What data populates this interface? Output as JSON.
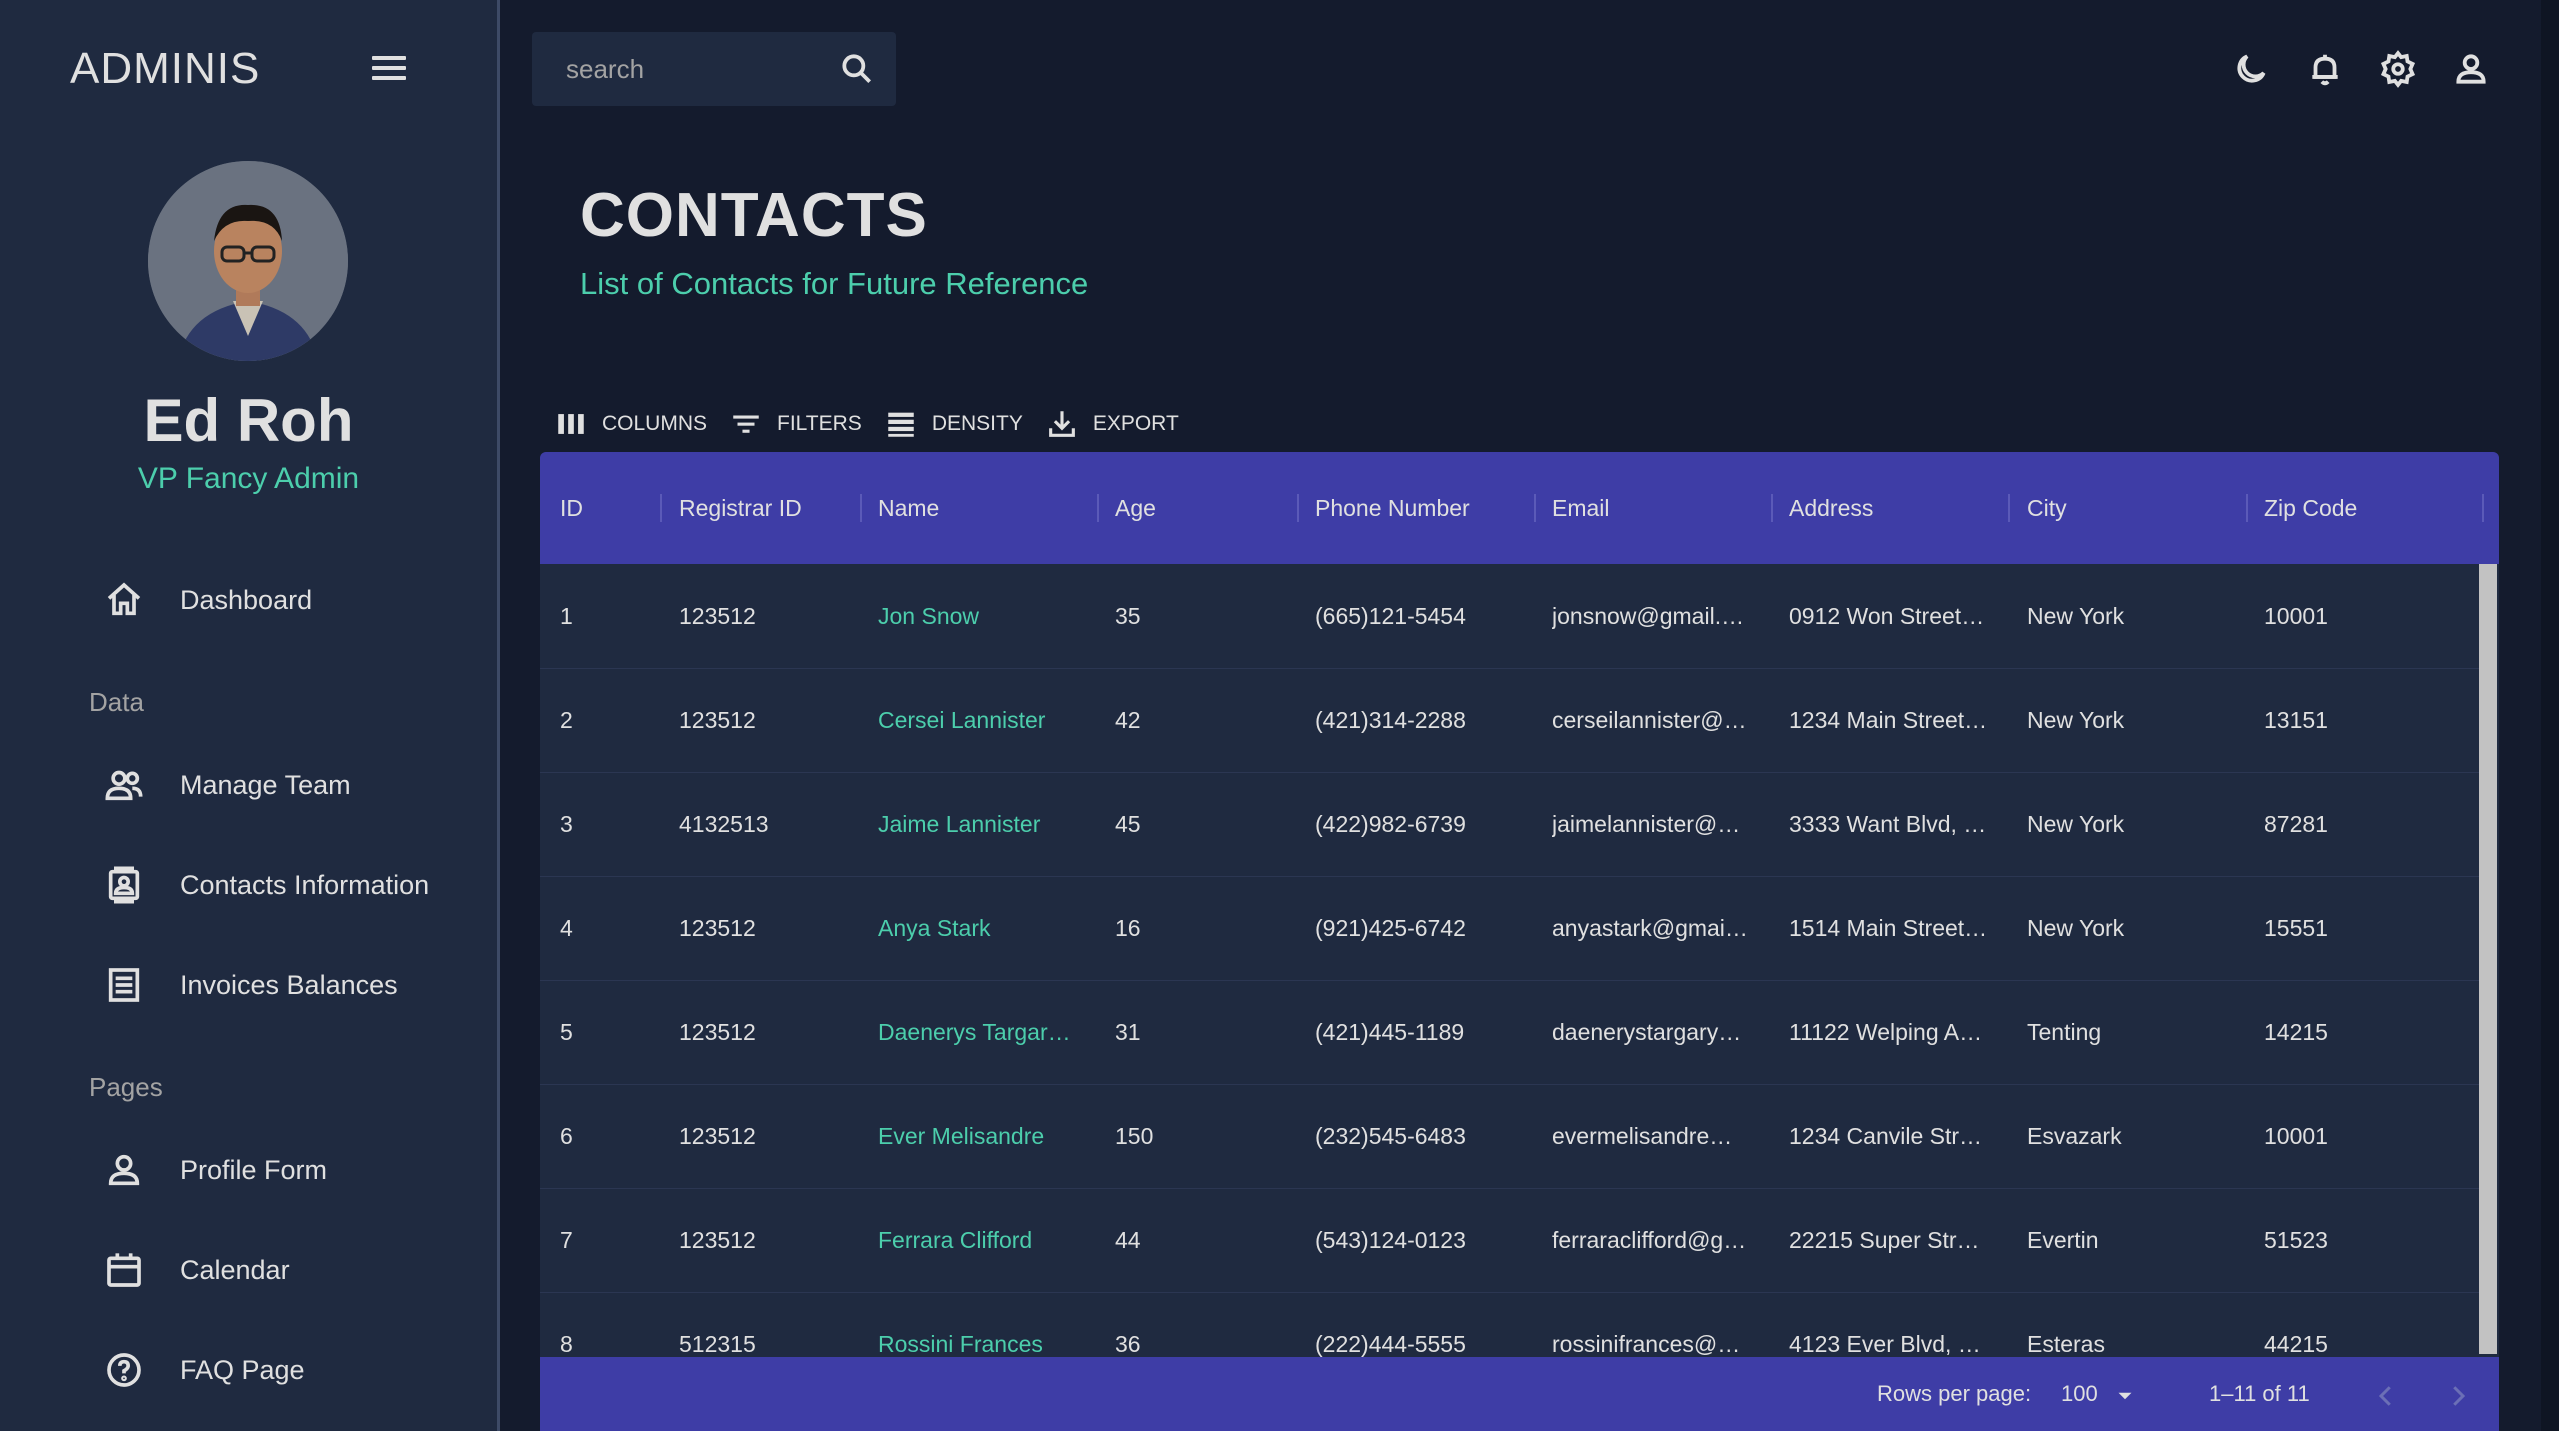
{
  "sidebar": {
    "brand": "ADMINIS",
    "user_name": "Ed Roh",
    "user_role": "VP Fancy Admin",
    "sections": [
      "Data",
      "Pages"
    ],
    "items": [
      {
        "label": "Dashboard",
        "icon": "home-icon"
      },
      {
        "label": "Manage Team",
        "icon": "people-icon"
      },
      {
        "label": "Contacts Information",
        "icon": "contacts-icon"
      },
      {
        "label": "Invoices Balances",
        "icon": "receipt-icon"
      },
      {
        "label": "Profile Form",
        "icon": "person-icon"
      },
      {
        "label": "Calendar",
        "icon": "calendar-icon"
      },
      {
        "label": "FAQ Page",
        "icon": "help-icon"
      }
    ]
  },
  "topbar": {
    "search_placeholder": "search",
    "icons": [
      "dark-mode-icon",
      "notifications-icon",
      "settings-icon",
      "profile-icon"
    ]
  },
  "header": {
    "title": "CONTACTS",
    "subtitle": "List of Contacts for Future Reference"
  },
  "toolbar": {
    "columns": "COLUMNS",
    "filters": "FILTERS",
    "density": "DENSITY",
    "export": "EXPORT"
  },
  "table": {
    "headers": [
      "ID",
      "Registrar ID",
      "Name",
      "Age",
      "Phone Number",
      "Email",
      "Address",
      "City",
      "Zip Code"
    ],
    "rows": [
      [
        "1",
        "123512",
        "Jon Snow",
        "35",
        "(665)121-5454",
        "jonsnow@gmail.…",
        "0912 Won Street, …",
        "New York",
        "10001"
      ],
      [
        "2",
        "123512",
        "Cersei Lannister",
        "42",
        "(421)314-2288",
        "cerseilannister@…",
        "1234 Main Street,…",
        "New York",
        "13151"
      ],
      [
        "3",
        "4132513",
        "Jaime Lannister",
        "45",
        "(422)982-6739",
        "jaimelannister@…",
        "3333 Want Blvd, …",
        "New York",
        "87281"
      ],
      [
        "4",
        "123512",
        "Anya Stark",
        "16",
        "(921)425-6742",
        "anyastark@gmail…",
        "1514 Main Street,…",
        "New York",
        "15551"
      ],
      [
        "5",
        "123512",
        "Daenerys Targary…",
        "31",
        "(421)445-1189",
        "daenerystargary…",
        "11122 Welping A…",
        "Tenting",
        "14215"
      ],
      [
        "6",
        "123512",
        "Ever Melisandre",
        "150",
        "(232)545-6483",
        "evermelisandre…",
        "1234 Canvile Stre…",
        "Esvazark",
        "10001"
      ],
      [
        "7",
        "123512",
        "Ferrara Clifford",
        "44",
        "(543)124-0123",
        "ferraraclifford@g…",
        "22215 Super Stre…",
        "Evertin",
        "51523"
      ],
      [
        "8",
        "512315",
        "Rossini Frances",
        "36",
        "(222)444-5555",
        "rossinifrances@g…",
        "4123 Ever Blvd, …",
        "Esteras",
        "44215"
      ]
    ],
    "rows_per_page_label": "Rows per page:",
    "rows_per_page_value": "100",
    "pagination_range": "1–11 of 11"
  },
  "colors": {
    "background": "#141b2d",
    "sidebar": "#1f2a40",
    "accent_green": "#4cceac",
    "header_blue": "#3e3da6"
  }
}
